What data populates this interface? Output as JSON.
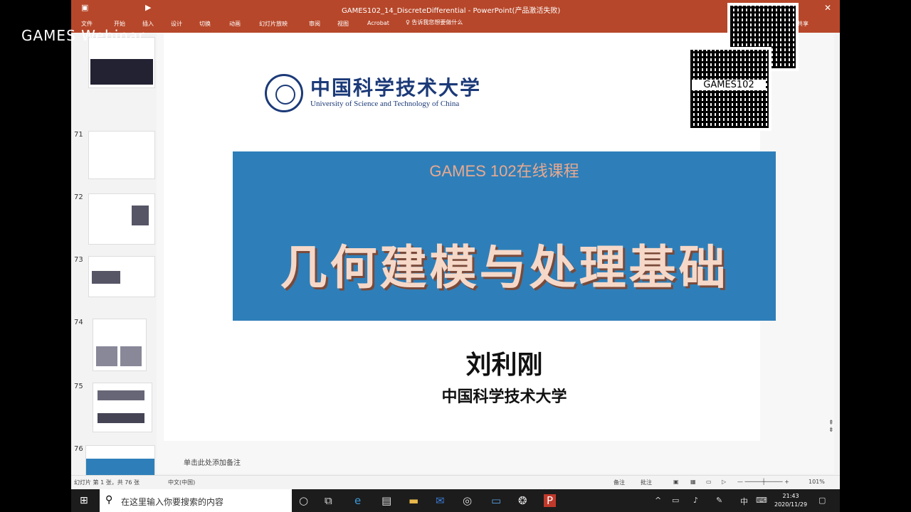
{
  "window": {
    "title": "GAMES102_14_DiscreteDifferential - PowerPoint(产品激活失败)",
    "tabs": [
      "文件",
      "开始",
      "插入",
      "设计",
      "切换",
      "动画",
      "幻灯片放映",
      "审阅",
      "视图",
      "Acrobat"
    ],
    "search_placeholder": "告诉我您想要做什么",
    "share_label": "共享",
    "accent_color": "#b7472a"
  },
  "watermark": "GAMES Webinar",
  "thumbnails": [
    {
      "number": "71"
    },
    {
      "number": "72"
    },
    {
      "number": "73"
    },
    {
      "number": "74"
    },
    {
      "number": "75"
    },
    {
      "number": "76"
    }
  ],
  "slide": {
    "logo_cn": "中国科学技术大学",
    "logo_en": "University of Science and Technology of China",
    "banner_subtitle": "GAMES 102在线课程",
    "banner_title": "几何建模与处理基础",
    "author": "刘利刚",
    "affiliation": "中国科学技术大学",
    "qr_label": "GAMES102",
    "banner_color": "#2e7fb9"
  },
  "notes_placeholder": "单击此处添加备注",
  "status": {
    "slide_count": "幻灯片 第 1 张，共 76 张",
    "language": "中文(中国)",
    "notes_btn": "备注",
    "comments_btn": "批注",
    "zoom": "101%"
  },
  "taskbar": {
    "search_placeholder": "在这里输入你要搜索的内容",
    "time": "21:43",
    "date": "2020/11/29",
    "ime": "中"
  }
}
